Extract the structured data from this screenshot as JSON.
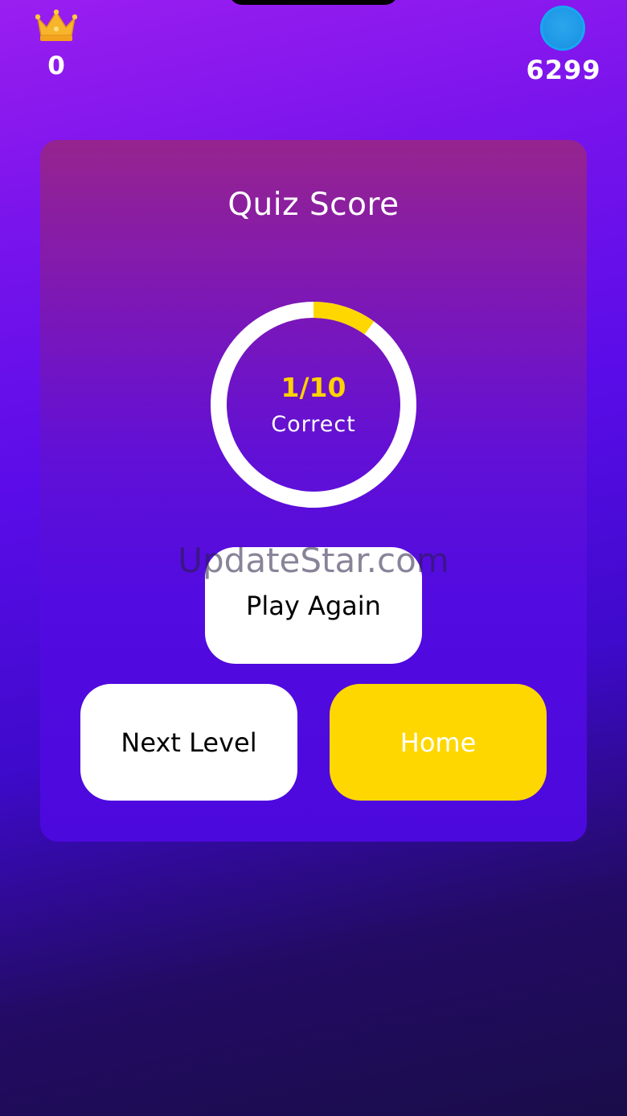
{
  "hud": {
    "crown_icon": "crown-icon",
    "crown_count": "0",
    "coin_icon": "coin-icon",
    "coin_count": "6299"
  },
  "card": {
    "title": "Quiz Score",
    "score": {
      "label": "1/10",
      "caption": "Correct",
      "correct": 1,
      "total": 10,
      "progress": 0.1
    },
    "buttons": {
      "play_again": "Play Again",
      "next_level": "Next Level",
      "home": "Home"
    }
  },
  "watermark": "UpdateStar.com",
  "colors": {
    "progress_fill": "#ffd700",
    "progress_track": "#ffffff",
    "score_text": "#ffd200",
    "home_button": "#ffd700"
  }
}
